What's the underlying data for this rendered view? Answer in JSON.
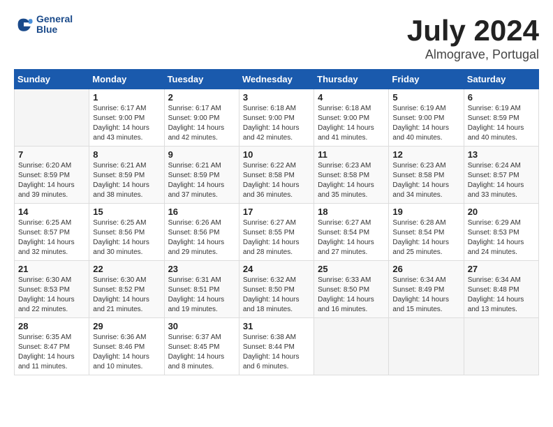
{
  "header": {
    "logo_line1": "General",
    "logo_line2": "Blue",
    "title": "July 2024",
    "subtitle": "Almograve, Portugal"
  },
  "weekdays": [
    "Sunday",
    "Monday",
    "Tuesday",
    "Wednesday",
    "Thursday",
    "Friday",
    "Saturday"
  ],
  "weeks": [
    [
      {
        "day": "",
        "sunrise": "",
        "sunset": "",
        "daylight": ""
      },
      {
        "day": "1",
        "sunrise": "Sunrise: 6:17 AM",
        "sunset": "Sunset: 9:00 PM",
        "daylight": "Daylight: 14 hours and 43 minutes."
      },
      {
        "day": "2",
        "sunrise": "Sunrise: 6:17 AM",
        "sunset": "Sunset: 9:00 PM",
        "daylight": "Daylight: 14 hours and 42 minutes."
      },
      {
        "day": "3",
        "sunrise": "Sunrise: 6:18 AM",
        "sunset": "Sunset: 9:00 PM",
        "daylight": "Daylight: 14 hours and 42 minutes."
      },
      {
        "day": "4",
        "sunrise": "Sunrise: 6:18 AM",
        "sunset": "Sunset: 9:00 PM",
        "daylight": "Daylight: 14 hours and 41 minutes."
      },
      {
        "day": "5",
        "sunrise": "Sunrise: 6:19 AM",
        "sunset": "Sunset: 9:00 PM",
        "daylight": "Daylight: 14 hours and 40 minutes."
      },
      {
        "day": "6",
        "sunrise": "Sunrise: 6:19 AM",
        "sunset": "Sunset: 8:59 PM",
        "daylight": "Daylight: 14 hours and 40 minutes."
      }
    ],
    [
      {
        "day": "7",
        "sunrise": "Sunrise: 6:20 AM",
        "sunset": "Sunset: 8:59 PM",
        "daylight": "Daylight: 14 hours and 39 minutes."
      },
      {
        "day": "8",
        "sunrise": "Sunrise: 6:21 AM",
        "sunset": "Sunset: 8:59 PM",
        "daylight": "Daylight: 14 hours and 38 minutes."
      },
      {
        "day": "9",
        "sunrise": "Sunrise: 6:21 AM",
        "sunset": "Sunset: 8:59 PM",
        "daylight": "Daylight: 14 hours and 37 minutes."
      },
      {
        "day": "10",
        "sunrise": "Sunrise: 6:22 AM",
        "sunset": "Sunset: 8:58 PM",
        "daylight": "Daylight: 14 hours and 36 minutes."
      },
      {
        "day": "11",
        "sunrise": "Sunrise: 6:23 AM",
        "sunset": "Sunset: 8:58 PM",
        "daylight": "Daylight: 14 hours and 35 minutes."
      },
      {
        "day": "12",
        "sunrise": "Sunrise: 6:23 AM",
        "sunset": "Sunset: 8:58 PM",
        "daylight": "Daylight: 14 hours and 34 minutes."
      },
      {
        "day": "13",
        "sunrise": "Sunrise: 6:24 AM",
        "sunset": "Sunset: 8:57 PM",
        "daylight": "Daylight: 14 hours and 33 minutes."
      }
    ],
    [
      {
        "day": "14",
        "sunrise": "Sunrise: 6:25 AM",
        "sunset": "Sunset: 8:57 PM",
        "daylight": "Daylight: 14 hours and 32 minutes."
      },
      {
        "day": "15",
        "sunrise": "Sunrise: 6:25 AM",
        "sunset": "Sunset: 8:56 PM",
        "daylight": "Daylight: 14 hours and 30 minutes."
      },
      {
        "day": "16",
        "sunrise": "Sunrise: 6:26 AM",
        "sunset": "Sunset: 8:56 PM",
        "daylight": "Daylight: 14 hours and 29 minutes."
      },
      {
        "day": "17",
        "sunrise": "Sunrise: 6:27 AM",
        "sunset": "Sunset: 8:55 PM",
        "daylight": "Daylight: 14 hours and 28 minutes."
      },
      {
        "day": "18",
        "sunrise": "Sunrise: 6:27 AM",
        "sunset": "Sunset: 8:54 PM",
        "daylight": "Daylight: 14 hours and 27 minutes."
      },
      {
        "day": "19",
        "sunrise": "Sunrise: 6:28 AM",
        "sunset": "Sunset: 8:54 PM",
        "daylight": "Daylight: 14 hours and 25 minutes."
      },
      {
        "day": "20",
        "sunrise": "Sunrise: 6:29 AM",
        "sunset": "Sunset: 8:53 PM",
        "daylight": "Daylight: 14 hours and 24 minutes."
      }
    ],
    [
      {
        "day": "21",
        "sunrise": "Sunrise: 6:30 AM",
        "sunset": "Sunset: 8:53 PM",
        "daylight": "Daylight: 14 hours and 22 minutes."
      },
      {
        "day": "22",
        "sunrise": "Sunrise: 6:30 AM",
        "sunset": "Sunset: 8:52 PM",
        "daylight": "Daylight: 14 hours and 21 minutes."
      },
      {
        "day": "23",
        "sunrise": "Sunrise: 6:31 AM",
        "sunset": "Sunset: 8:51 PM",
        "daylight": "Daylight: 14 hours and 19 minutes."
      },
      {
        "day": "24",
        "sunrise": "Sunrise: 6:32 AM",
        "sunset": "Sunset: 8:50 PM",
        "daylight": "Daylight: 14 hours and 18 minutes."
      },
      {
        "day": "25",
        "sunrise": "Sunrise: 6:33 AM",
        "sunset": "Sunset: 8:50 PM",
        "daylight": "Daylight: 14 hours and 16 minutes."
      },
      {
        "day": "26",
        "sunrise": "Sunrise: 6:34 AM",
        "sunset": "Sunset: 8:49 PM",
        "daylight": "Daylight: 14 hours and 15 minutes."
      },
      {
        "day": "27",
        "sunrise": "Sunrise: 6:34 AM",
        "sunset": "Sunset: 8:48 PM",
        "daylight": "Daylight: 14 hours and 13 minutes."
      }
    ],
    [
      {
        "day": "28",
        "sunrise": "Sunrise: 6:35 AM",
        "sunset": "Sunset: 8:47 PM",
        "daylight": "Daylight: 14 hours and 11 minutes."
      },
      {
        "day": "29",
        "sunrise": "Sunrise: 6:36 AM",
        "sunset": "Sunset: 8:46 PM",
        "daylight": "Daylight: 14 hours and 10 minutes."
      },
      {
        "day": "30",
        "sunrise": "Sunrise: 6:37 AM",
        "sunset": "Sunset: 8:45 PM",
        "daylight": "Daylight: 14 hours and 8 minutes."
      },
      {
        "day": "31",
        "sunrise": "Sunrise: 6:38 AM",
        "sunset": "Sunset: 8:44 PM",
        "daylight": "Daylight: 14 hours and 6 minutes."
      },
      {
        "day": "",
        "sunrise": "",
        "sunset": "",
        "daylight": ""
      },
      {
        "day": "",
        "sunrise": "",
        "sunset": "",
        "daylight": ""
      },
      {
        "day": "",
        "sunrise": "",
        "sunset": "",
        "daylight": ""
      }
    ]
  ]
}
